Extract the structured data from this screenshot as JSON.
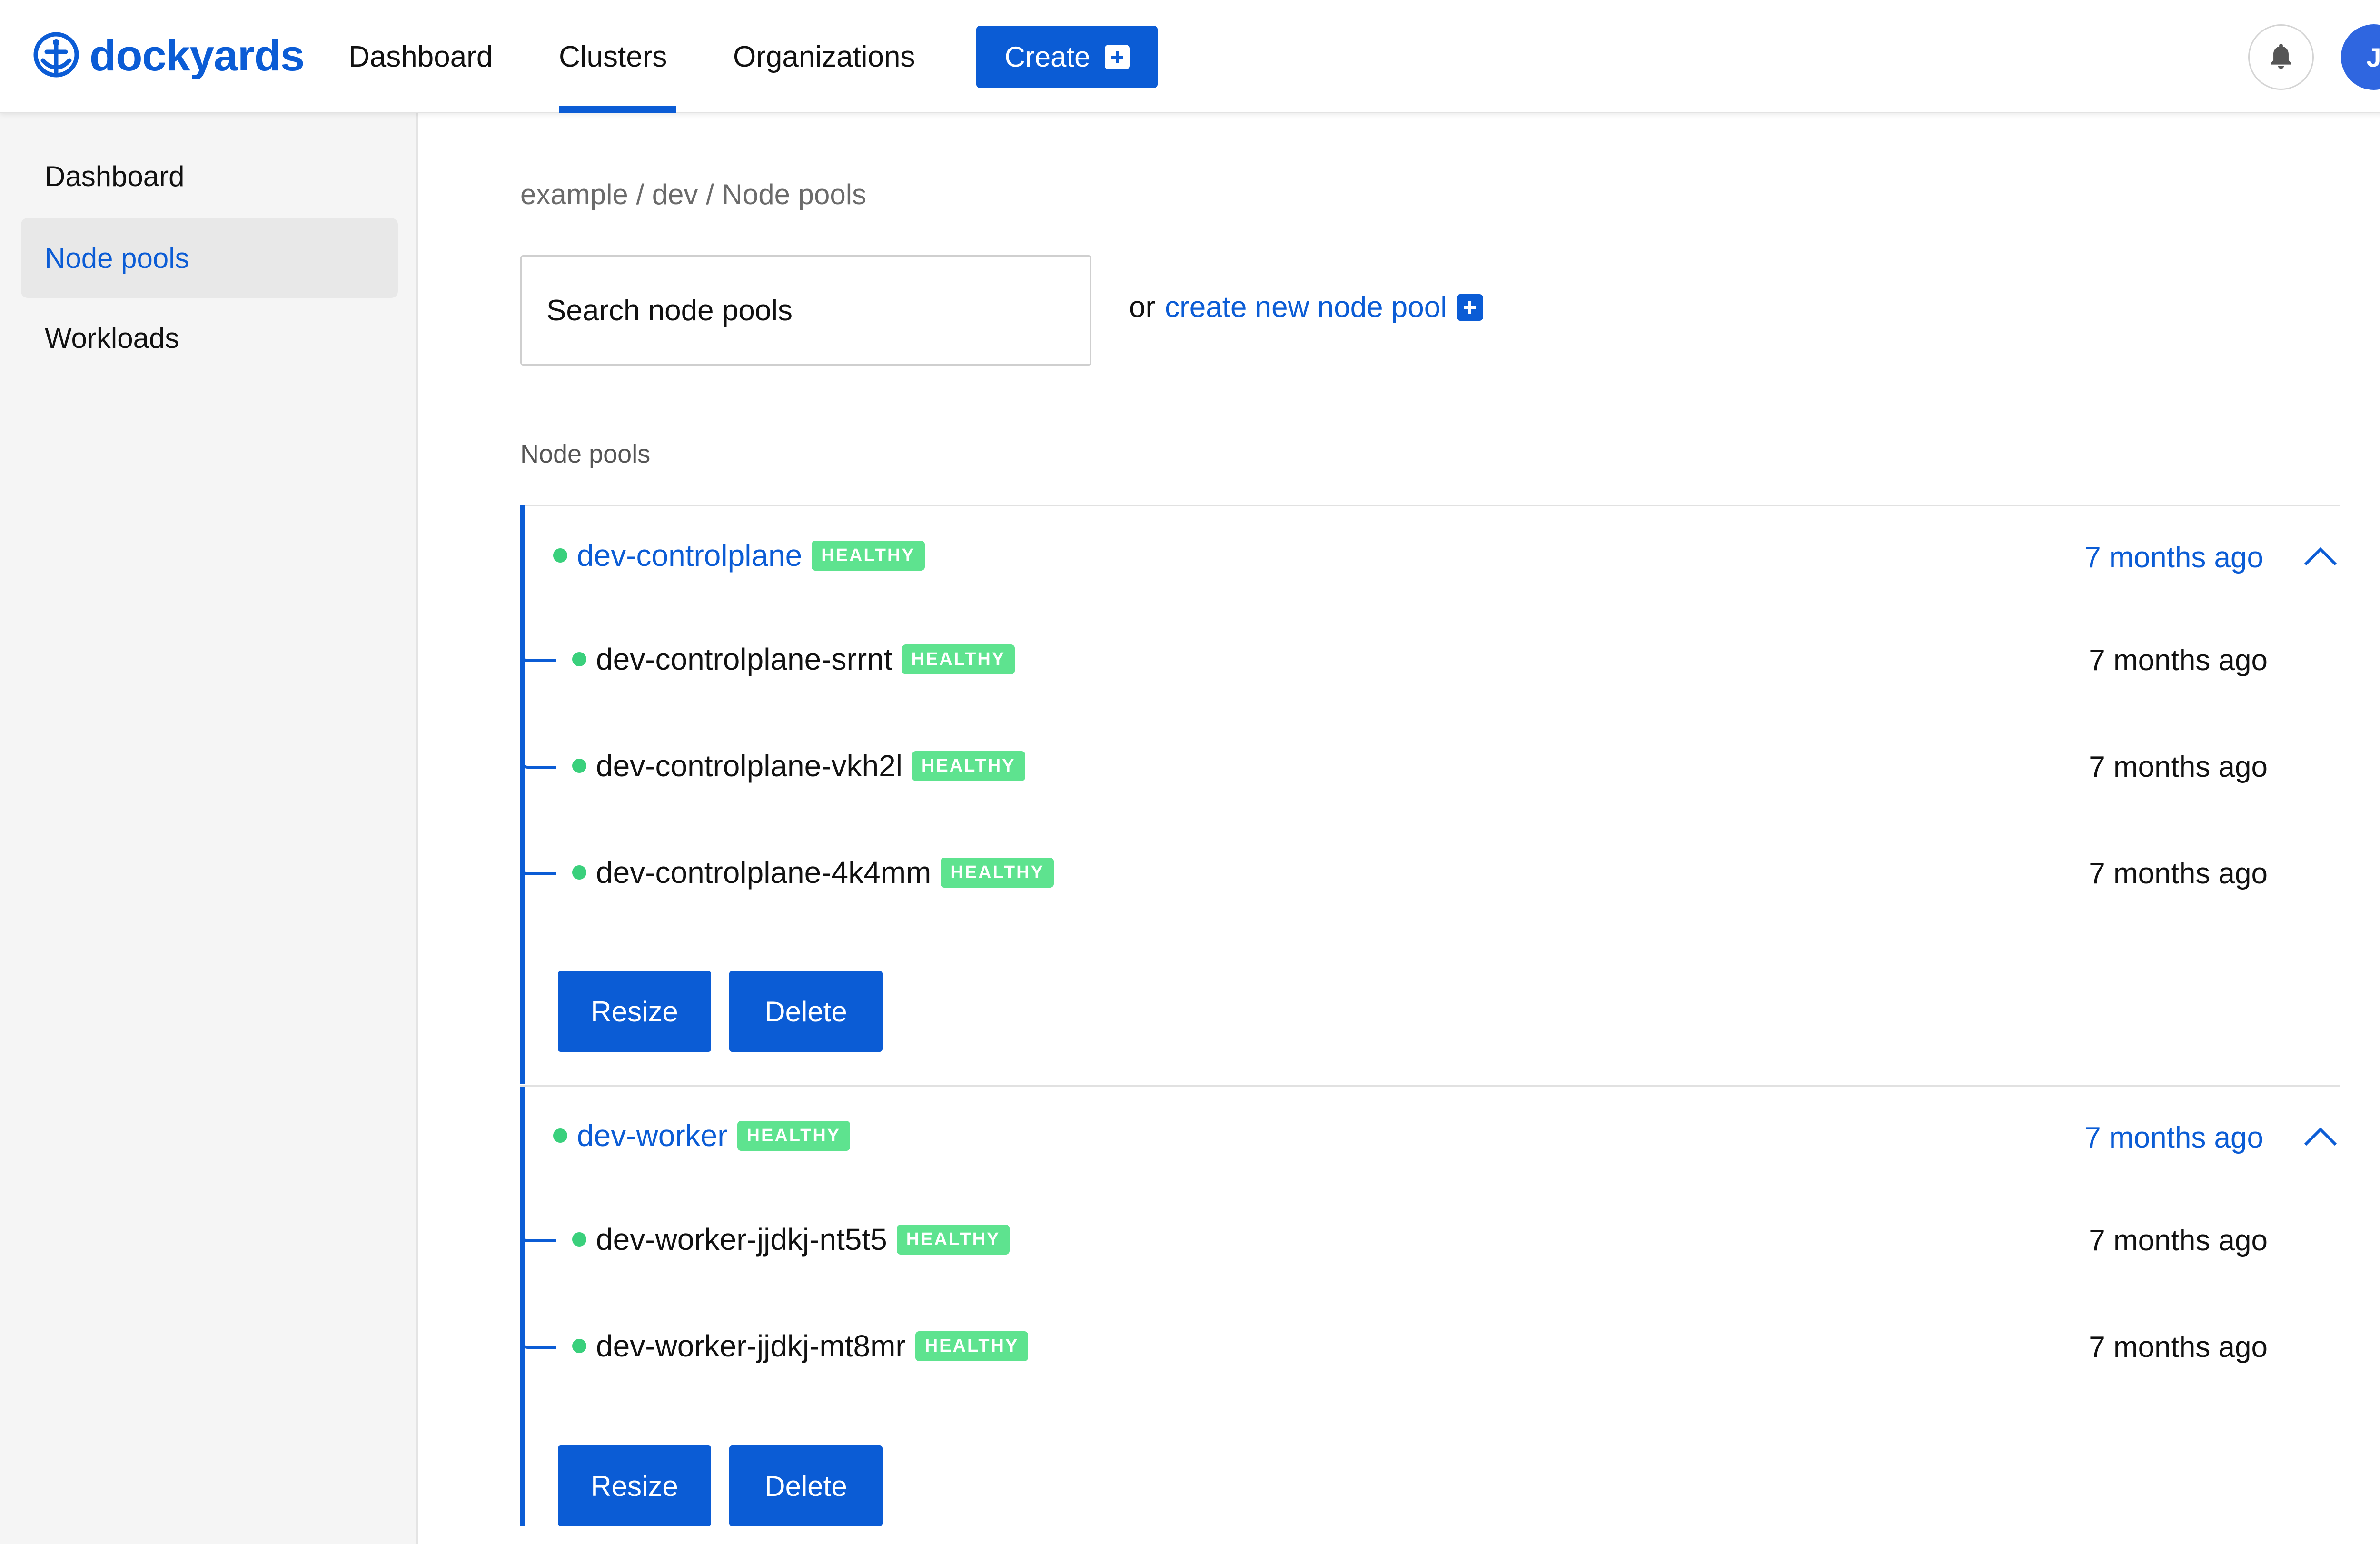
{
  "app": {
    "name": "dockyards"
  },
  "topnav": {
    "items": [
      {
        "label": "Dashboard"
      },
      {
        "label": "Clusters",
        "active": true
      },
      {
        "label": "Organizations"
      }
    ],
    "create_label": "Create",
    "avatar_initial": "J"
  },
  "sidebar": {
    "items": [
      {
        "label": "Dashboard"
      },
      {
        "label": "Node pools",
        "active": true
      },
      {
        "label": "Workloads"
      }
    ]
  },
  "breadcrumb": "example / dev / Node pools",
  "search": {
    "placeholder": "Search node pools"
  },
  "create_link": {
    "prefix": "or",
    "label": "create new node pool"
  },
  "section_label": "Node pools",
  "status_healthy": "HEALTHY",
  "colors": {
    "accent": "#0b5cd5",
    "healthy": "#5ee38f",
    "healthy_dot": "#3ad07c"
  },
  "pools": [
    {
      "name": "dev-controlplane",
      "status": "HEALTHY",
      "age": "7 months ago",
      "nodes": [
        {
          "name": "dev-controlplane-srrnt",
          "status": "HEALTHY",
          "age": "7 months ago"
        },
        {
          "name": "dev-controlplane-vkh2l",
          "status": "HEALTHY",
          "age": "7 months ago"
        },
        {
          "name": "dev-controlplane-4k4mm",
          "status": "HEALTHY",
          "age": "7 months ago"
        }
      ],
      "actions": {
        "resize": "Resize",
        "delete": "Delete"
      }
    },
    {
      "name": "dev-worker",
      "status": "HEALTHY",
      "age": "7 months ago",
      "nodes": [
        {
          "name": "dev-worker-jjdkj-nt5t5",
          "status": "HEALTHY",
          "age": "7 months ago"
        },
        {
          "name": "dev-worker-jjdkj-mt8mr",
          "status": "HEALTHY",
          "age": "7 months ago"
        }
      ],
      "actions": {
        "resize": "Resize",
        "delete": "Delete"
      }
    }
  ]
}
